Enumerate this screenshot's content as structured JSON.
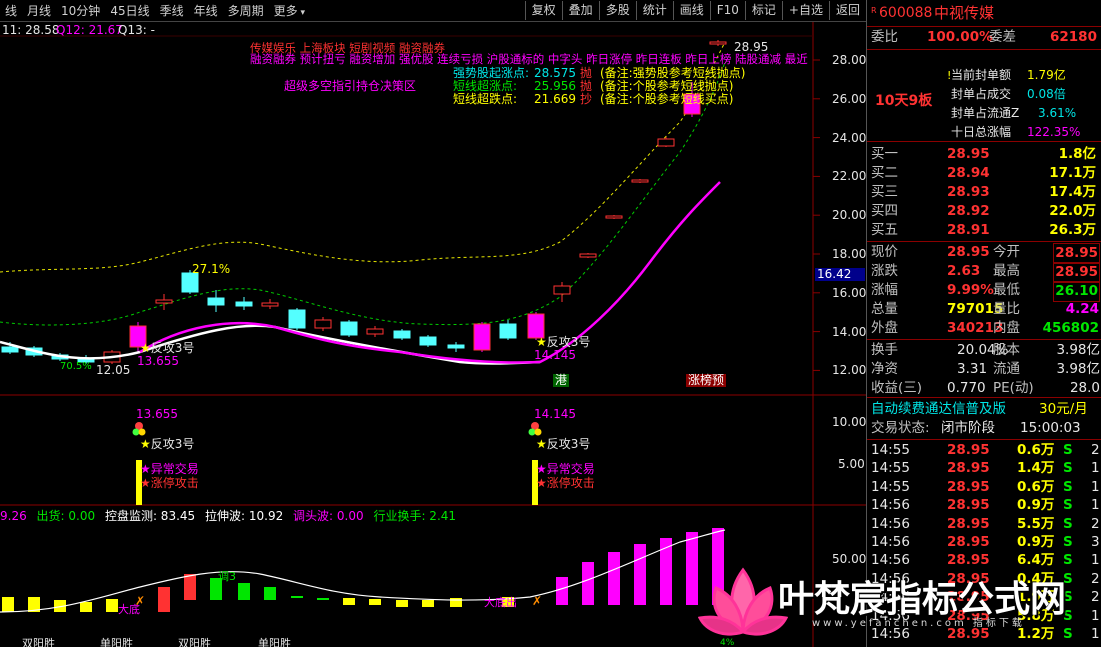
{
  "toolbar": {
    "periods": [
      "线",
      "月线",
      "10分钟",
      "45日线",
      "季线",
      "年线",
      "多周期",
      "更多"
    ],
    "buttons": [
      "复权",
      "叠加",
      "多股",
      "统计",
      "画线",
      "F10",
      "标记",
      "+自选",
      "返回"
    ]
  },
  "chart": {
    "header_values": {
      "left": "11: 28.58",
      "q12": "Q12: 21.67",
      "q13": "Q13: -"
    },
    "y_axis_top": [
      "28.00",
      "26.00",
      "24.00",
      "22.00",
      "20.00",
      "18.00",
      "16.00",
      "14.00",
      "12.00"
    ],
    "current_price_tag": "16.42",
    "y_axis_mid": [
      "10.00",
      "5.00"
    ],
    "y_axis_bottom": [
      "50.00"
    ],
    "concepts_line1": "传媒娱乐  上海板块  短剧视频  融资融券",
    "concepts_line2": "融资融券 预计扭亏 融资增加 强优股 连续亏损 沪股通标的 中字头 昨日涨停 昨日连板 昨日上榜 陆股通减 最近",
    "signals": [
      {
        "name": "强势股起涨点:",
        "value": "28.575",
        "action": "抛",
        "note": "(备注:强势股参考短线抛点)"
      },
      {
        "name": "短线超涨点:",
        "value": "25.956",
        "action": "抛",
        "note": "(备注:个股参考短线抛点)"
      },
      {
        "name": "短线超跌点:",
        "value": "21.669",
        "action": "抄",
        "note": "(备注:个股参考短线买点)"
      }
    ],
    "hint": "超级多空指引持仓决策区",
    "price_labels": {
      "high": "28.95",
      "pct": "27.1%",
      "low1": "13.655",
      "low2": "14.145",
      "low3": "12.05",
      "pct2": "70.5%"
    },
    "markers": {
      "fangong": "反攻3号",
      "yichang": "异常交易",
      "zhangting": "涨停攻击",
      "gang": "港",
      "zbg": "涨榜预"
    },
    "mid_values": {
      "a": "13.655",
      "b": "14.145"
    },
    "bottom_header": [
      {
        "label": "9.26",
        "color": "#ff00ff"
      },
      {
        "label": "出货: 0.00",
        "color": "#00e600"
      },
      {
        "label": "控盘监测: 83.45",
        "color": "#ffffff"
      },
      {
        "label": "拉伸波: 10.92",
        "color": "#ffffff"
      },
      {
        "label": "调头波: 0.00",
        "color": "#ff00ff"
      },
      {
        "label": "行业换手: 2.41",
        "color": "#00e600"
      }
    ],
    "bottom_labels": {
      "tiao1": "调3",
      "dadi": "大底",
      "dadichu": "大底出",
      "pct": "4%"
    },
    "bottom_axis_labels": [
      "双阳胜",
      "单阳胜",
      "双阳胜",
      "单阳胜"
    ]
  },
  "panel": {
    "code": "600088",
    "name": "中视传媒",
    "weibi_label": "委比",
    "weibi_value": "100.00%",
    "weicha_label": "委差",
    "weicha_value": "62180",
    "tag": "10天9板",
    "seal_stats": [
      {
        "label": "当前封单额",
        "value": "1.79亿"
      },
      {
        "label": "封单占成交",
        "value": "0.08倍"
      },
      {
        "label": "封单占流通Z",
        "value": "3.61%"
      },
      {
        "label": "十日总涨幅",
        "value": "122.35%"
      }
    ],
    "bids": [
      {
        "label": "买一",
        "price": "28.95",
        "vol": "1.8亿"
      },
      {
        "label": "买二",
        "price": "28.94",
        "vol": "17.1万"
      },
      {
        "label": "买三",
        "price": "28.93",
        "vol": "17.4万"
      },
      {
        "label": "买四",
        "price": "28.92",
        "vol": "22.0万"
      },
      {
        "label": "买五",
        "price": "28.91",
        "vol": "26.3万"
      }
    ],
    "quote": [
      {
        "l1": "现价",
        "v1": "28.95",
        "l2": "今开",
        "v2": "28.95"
      },
      {
        "l1": "涨跌",
        "v1": "2.63",
        "l2": "最高",
        "v2": "28.95"
      },
      {
        "l1": "涨幅",
        "v1": "9.99%",
        "l2": "最低",
        "v2": "26.10"
      },
      {
        "l1": "总量",
        "v1": "797015",
        "l2": "量比",
        "v2": "4.24"
      },
      {
        "l1": "外盘",
        "v1": "340213",
        "l2": "内盘",
        "v2": "456802"
      }
    ],
    "stats": [
      {
        "l1": "换手",
        "v1": "20.04%",
        "l2": "股本",
        "v2": "3.98亿"
      },
      {
        "l1": "净资",
        "v1": "3.31",
        "l2": "流通",
        "v2": "3.98亿"
      },
      {
        "l1": "收益(三)",
        "v1": "0.770",
        "l2": "PE(动)",
        "v2": "28.0"
      }
    ],
    "promo": "自动续费通达信普及版",
    "price_tag": "30元/月",
    "status_label": "交易状态:",
    "status_value": "闭市阶段",
    "status_time": "15:00:03",
    "ticks": [
      {
        "time": "14:55",
        "price": "28.95",
        "vol": "0.6万",
        "side": "S",
        "n": "2"
      },
      {
        "time": "14:55",
        "price": "28.95",
        "vol": "1.4万",
        "side": "S",
        "n": "1"
      },
      {
        "time": "14:55",
        "price": "28.95",
        "vol": "0.6万",
        "side": "S",
        "n": "1"
      },
      {
        "time": "14:56",
        "price": "28.95",
        "vol": "0.9万",
        "side": "S",
        "n": "1"
      },
      {
        "time": "14:56",
        "price": "28.95",
        "vol": "5.5万",
        "side": "S",
        "n": "2"
      },
      {
        "time": "14:56",
        "price": "28.95",
        "vol": "0.9万",
        "side": "S",
        "n": "3"
      },
      {
        "time": "14:56",
        "price": "28.95",
        "vol": "6.4万",
        "side": "S",
        "n": "1"
      },
      {
        "time": "14:56",
        "price": "28.95",
        "vol": "0.4万",
        "side": "S",
        "n": "2"
      },
      {
        "time": "14:56",
        "price": "28.95",
        "vol": "1.9万",
        "side": "S",
        "n": "2"
      },
      {
        "time": "14:56",
        "price": "28.95",
        "vol": "5.8万",
        "side": "S",
        "n": "1"
      },
      {
        "time": "14:56",
        "price": "28.95",
        "vol": "1.2万",
        "side": "S",
        "n": "1"
      }
    ]
  },
  "watermark": {
    "text": "叶梵宸指标公式网",
    "url": "www.yefanchen.com 指标下载"
  },
  "colors": {
    "up": "#ff3232",
    "down": "#00e6e6",
    "ma_main": "#ff00ff",
    "label_yellow": "#ffff00",
    "border": "#8b0000"
  }
}
